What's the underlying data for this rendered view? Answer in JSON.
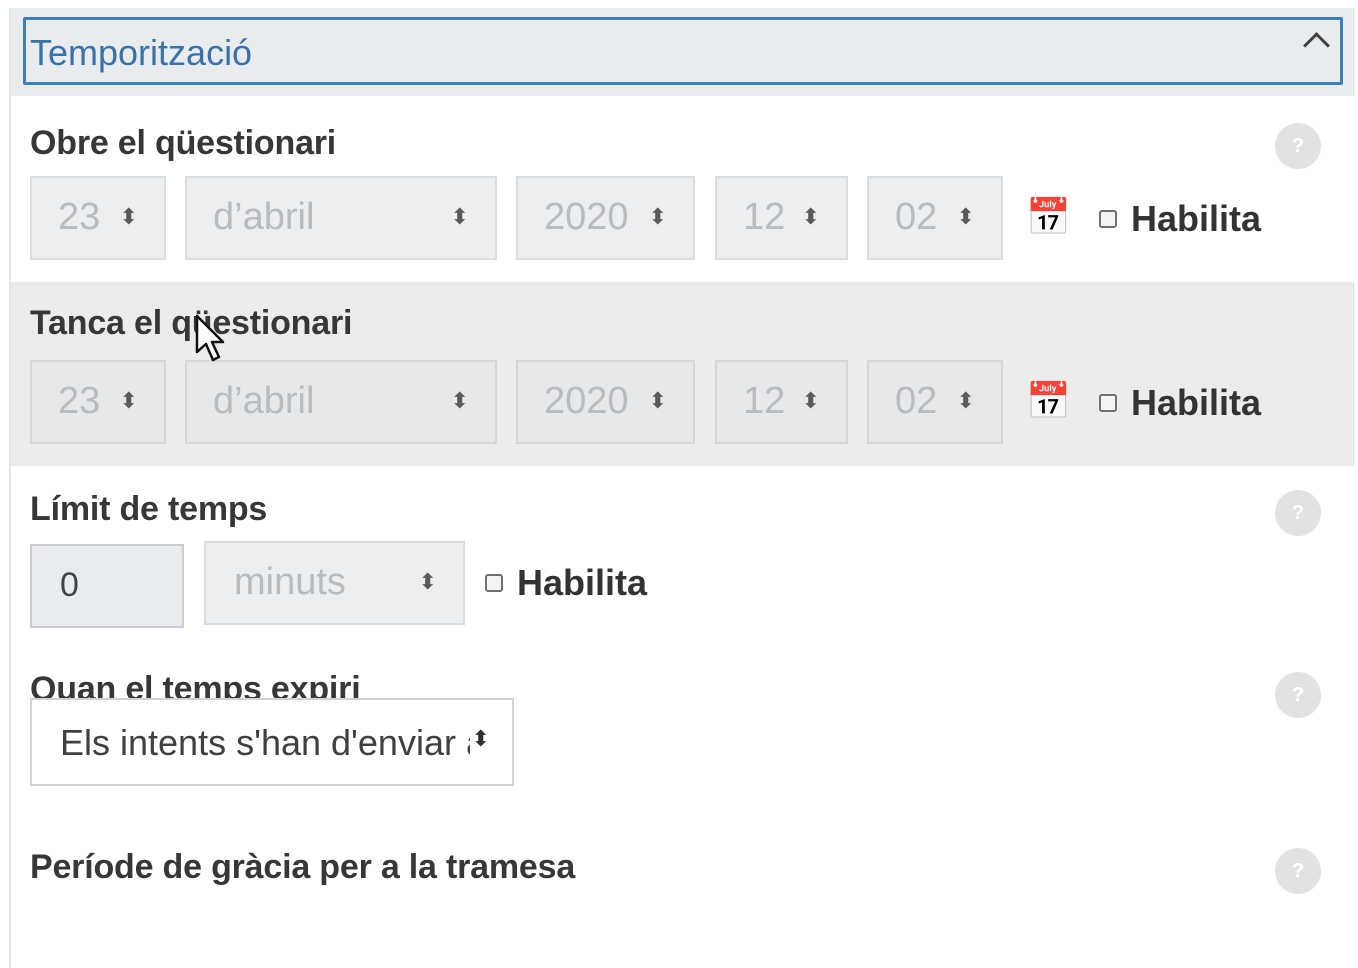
{
  "section": {
    "title": "Temporització"
  },
  "open_quiz": {
    "label": "Obre el qüestionari",
    "day": "23",
    "month": "d’abril",
    "year": "2020",
    "hour": "12",
    "minute": "02",
    "enable_label": "Habilita"
  },
  "close_quiz": {
    "label": "Tanca el qüestionari",
    "day": "23",
    "month": "d’abril",
    "year": "2020",
    "hour": "12",
    "minute": "02",
    "enable_label": "Habilita"
  },
  "time_limit": {
    "label": "Límit de temps",
    "value": "0",
    "unit": "minuts",
    "enable_label": "Habilita"
  },
  "when_expires": {
    "label": "Quan el temps expiri",
    "value": "Els intents s'han d'enviar automàticament"
  },
  "grace_period": {
    "label": "Període de gràcia per a la tramesa"
  },
  "help_glyph": "?",
  "select_arrow": "⬍",
  "calendar_glyph": "📅"
}
